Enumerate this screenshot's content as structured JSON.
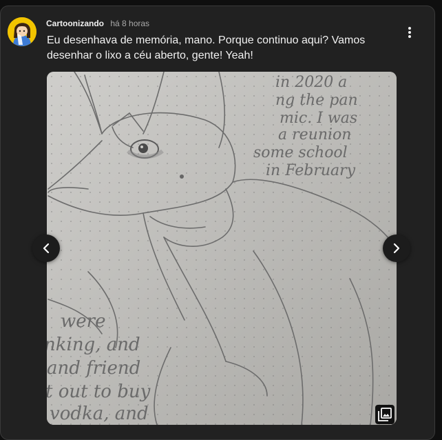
{
  "post": {
    "author": "Cartoonizando",
    "time": "há 8 horas",
    "text": "Eu desenhava de memória, mano. Porque continuo aqui? Vamos desenhar o lixo a céu aberto, gente! Yeah!"
  },
  "image": {
    "handwriting_top": [
      "in 2020 a",
      "ng the pan",
      "mic. I was",
      "a reunion",
      "some school",
      "in February"
    ],
    "handwriting_bottom": [
      "were",
      "nking, and",
      "and friend",
      "t out to buy",
      "vodka, and"
    ]
  },
  "icons": {
    "menu": "more-vert-icon",
    "prev": "chevron-left-icon",
    "next": "chevron-right-icon",
    "gallery": "image-stack-icon"
  },
  "colors": {
    "card_bg": "#212121",
    "page_bg": "#0f0f0f",
    "text": "#f1f1f1",
    "secondary_text": "#aaaaaa",
    "paper": "#bdbcb8",
    "pencil": "#6c6c6c"
  }
}
